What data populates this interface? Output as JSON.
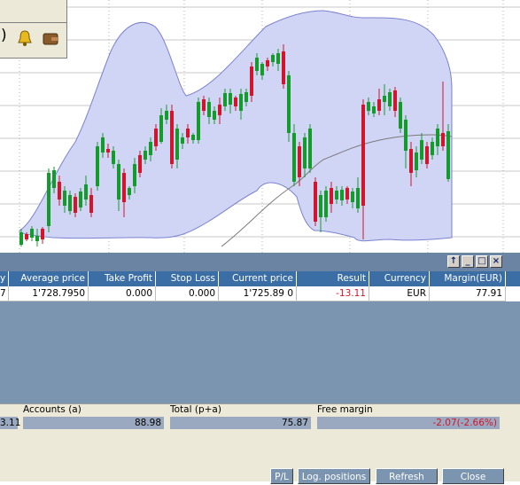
{
  "toolbar": {
    "paren_glyph": ")",
    "icons": [
      "bell-icon",
      "wallet-icon"
    ]
  },
  "chart": {
    "band_fill": "#d0d4f5",
    "band_stroke": "#7a82d0",
    "bull_color": "#139c2b",
    "bear_color": "#d5142b",
    "grid_color": "#b0b0b0",
    "mid_line_color": "#7a7a7a"
  },
  "positions_panel": {
    "columns": [
      {
        "key": "qty",
        "label": "y"
      },
      {
        "key": "avg",
        "label": "Average price"
      },
      {
        "key": "tp",
        "label": "Take Profit"
      },
      {
        "key": "sl",
        "label": "Stop Loss"
      },
      {
        "key": "cur",
        "label": "Current price"
      },
      {
        "key": "res",
        "label": "Result"
      },
      {
        "key": "ccy",
        "label": "Currency"
      },
      {
        "key": "mgn",
        "label": "Margin(EUR)"
      }
    ],
    "row": {
      "qty": "7",
      "avg": "1'728.7950",
      "tp": "0.000",
      "sl": "0.000",
      "cur": "1'725.89 0",
      "res": "-13.11",
      "ccy": "EUR",
      "mgn": "77.91"
    },
    "result_color": "#d5142b"
  },
  "summary": {
    "left_value": "3.11",
    "accounts_label": "Accounts (a)",
    "accounts_value": "88.98",
    "total_label": "Total (p+a)",
    "total_value": "75.87",
    "free_margin_label": "Free margin",
    "free_margin_value": "-2.07(-2.66%)"
  },
  "buttons": {
    "pl": "P/L",
    "log_positions": "Log. positions",
    "refresh": "Refresh",
    "close": "Close"
  }
}
